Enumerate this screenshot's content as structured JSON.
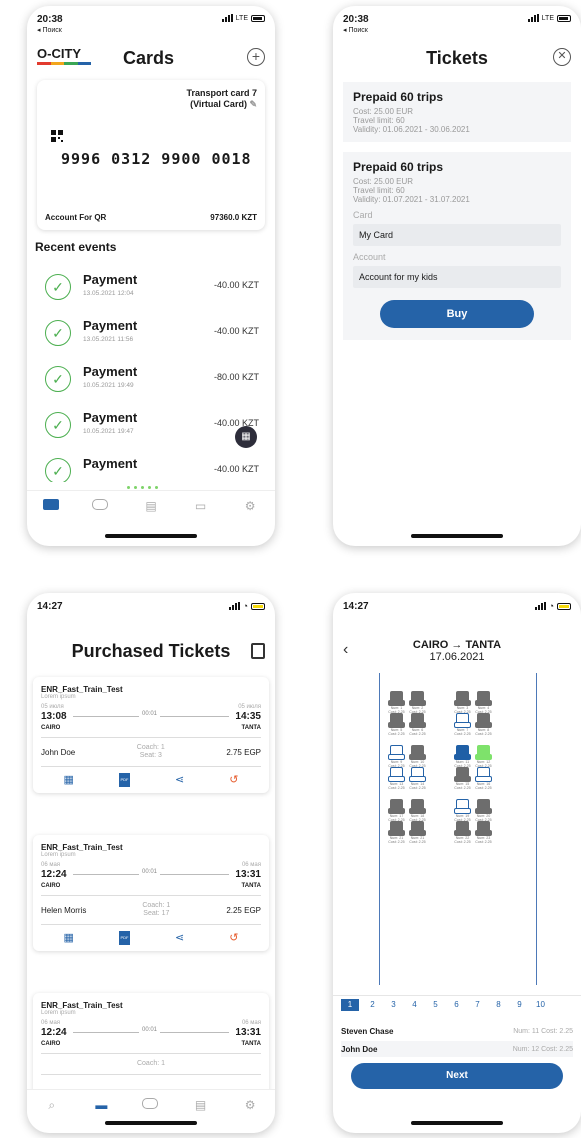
{
  "colors": {
    "accent": "#2563a8",
    "success": "#4caf50",
    "seat_green": "#7ee26b",
    "cancel": "#e65a2b"
  },
  "screen1": {
    "status": {
      "time": "20:38",
      "back": "◂ Поиск",
      "network": "LTE"
    },
    "logo": "O-CITY",
    "title": "Cards",
    "card": {
      "title_line1": "Transport card 7",
      "title_line2": "(Virtual Card)",
      "number": "9996 0312 9900 0018",
      "account": "Account For QR",
      "balance": "97360.0 KZT"
    },
    "recent_title": "Recent events",
    "events": [
      {
        "title": "Payment",
        "date": "13.05.2021 12:04",
        "amount": "-40.00 KZT"
      },
      {
        "title": "Payment",
        "date": "13.05.2021 11:56",
        "amount": "-40.00 KZT"
      },
      {
        "title": "Payment",
        "date": "10.05.2021 19:49",
        "amount": "-80.00 KZT"
      },
      {
        "title": "Payment",
        "date": "10.05.2021 19:47",
        "amount": "-40.00 KZT"
      },
      {
        "title": "Payment",
        "date": "",
        "amount": "-40.00 KZT"
      }
    ]
  },
  "screen2": {
    "status": {
      "time": "20:38",
      "back": "◂ Поиск",
      "network": "LTE"
    },
    "title": "Tickets",
    "packages": [
      {
        "title": "Prepaid 60 trips",
        "cost": "Cost: 25.00 EUR",
        "limit": "Travel limit: 60",
        "validity": "Validity: 01.06.2021 - 30.06.2021"
      },
      {
        "title": "Prepaid 60 trips",
        "cost": "Cost: 25.00 EUR",
        "limit": "Travel limit: 60",
        "validity": "Validity: 01.07.2021 - 31.07.2021",
        "card_label": "Card",
        "card_value": "My Card",
        "account_label": "Account",
        "account_value": "Account for my kids",
        "buy_label": "Buy"
      }
    ]
  },
  "screen3": {
    "status": {
      "time": "14:27"
    },
    "title": "Purchased Tickets",
    "tickets": [
      {
        "name": "ENR_Fast_Train_Test",
        "sub": "Lorem ipsum",
        "dep_date": "05 июля",
        "arr_date": "05 июля",
        "dep_time": "13:08",
        "arr_time": "14:35",
        "duration": "00:01",
        "from": "CAIRO",
        "to": "TANTA",
        "passenger": "John Doe",
        "coach": "Coach: 1",
        "seat": "Seat: 3",
        "price": "2.75 EGP"
      },
      {
        "name": "ENR_Fast_Train_Test",
        "sub": "Lorem ipsum",
        "dep_date": "06 мая",
        "arr_date": "06 мая",
        "dep_time": "12:24",
        "arr_time": "13:31",
        "duration": "00:01",
        "from": "CAIRO",
        "to": "TANTA",
        "passenger": "Helen Morris",
        "coach": "Coach: 1",
        "seat": "Seat: 17",
        "price": "2.25 EGP"
      },
      {
        "name": "ENR_Fast_Train_Test",
        "sub": "Lorem ipsum",
        "dep_date": "06 мая",
        "arr_date": "06 мая",
        "dep_time": "12:24",
        "arr_time": "13:31",
        "duration": "00:01",
        "from": "CAIRO",
        "to": "TANTA",
        "coach": "Coach: 1"
      }
    ],
    "pdf_label": "PDF"
  },
  "screen4": {
    "status": {
      "time": "14:27"
    },
    "route": "CAIRO → TANTA",
    "date": "17.06.2021",
    "seat_rows": [
      [
        {
          "num": "Num: 1",
          "cost": "Cost: 2.25",
          "state": "taken"
        },
        {
          "num": "Num: 2",
          "cost": "Cost: 2.25",
          "state": "taken"
        },
        {
          "num": "Num: 3",
          "cost": "Cost: 2.25",
          "state": "taken"
        },
        {
          "num": "Num: 4",
          "cost": "Cost: 2.25",
          "state": "taken"
        }
      ],
      [
        {
          "num": "Num: 5",
          "cost": "Cost: 2.25",
          "state": "taken"
        },
        {
          "num": "Num: 6",
          "cost": "Cost: 2.25",
          "state": "taken"
        },
        {
          "num": "Num: 7",
          "cost": "Cost: 2.25",
          "state": "free"
        },
        {
          "num": "Num: 8",
          "cost": "Cost: 2.25",
          "state": "taken"
        }
      ],
      [
        {
          "num": "Num: 9",
          "cost": "Cost: 2.25",
          "state": "free"
        },
        {
          "num": "Num: 10",
          "cost": "Cost: 2.25",
          "state": "taken"
        },
        {
          "num": "Num: 11",
          "cost": "Cost: 2.25",
          "state": "sel"
        },
        {
          "num": "Num: 12",
          "cost": "Cost: 2.25",
          "state": "green"
        }
      ],
      [
        {
          "num": "Num: 13",
          "cost": "Cost: 2.25",
          "state": "free"
        },
        {
          "num": "Num: 14",
          "cost": "Cost: 2.25",
          "state": "free"
        },
        {
          "num": "Num: 15",
          "cost": "Cost: 2.25",
          "state": "taken"
        },
        {
          "num": "Num: 16",
          "cost": "Cost: 2.25",
          "state": "free"
        }
      ],
      [
        {
          "num": "Num: 17",
          "cost": "Cost: 2.25",
          "state": "taken"
        },
        {
          "num": "Num: 18",
          "cost": "Cost: 2.25",
          "state": "taken"
        },
        {
          "num": "Num: 19",
          "cost": "Cost: 2.25",
          "state": "free"
        },
        {
          "num": "Num: 20",
          "cost": "Cost: 2.25",
          "state": "taken"
        }
      ],
      [
        {
          "num": "Num: 21",
          "cost": "Cost: 2.25",
          "state": "taken"
        },
        {
          "num": "Num: 21",
          "cost": "Cost: 2.25",
          "state": "taken"
        },
        {
          "num": "Num: 22",
          "cost": "Cost: 2.25",
          "state": "taken"
        },
        {
          "num": "Num: 23",
          "cost": "Cost: 2.25",
          "state": "taken"
        }
      ]
    ],
    "pages": [
      "1",
      "2",
      "3",
      "4",
      "5",
      "6",
      "7",
      "8",
      "9",
      "10"
    ],
    "passengers": [
      {
        "name": "Steven Chase",
        "seat": "Num: 11  Cost: 2.25"
      },
      {
        "name": "John Doe",
        "seat": "Num: 12  Cost: 2.25"
      }
    ],
    "next_label": "Next"
  }
}
